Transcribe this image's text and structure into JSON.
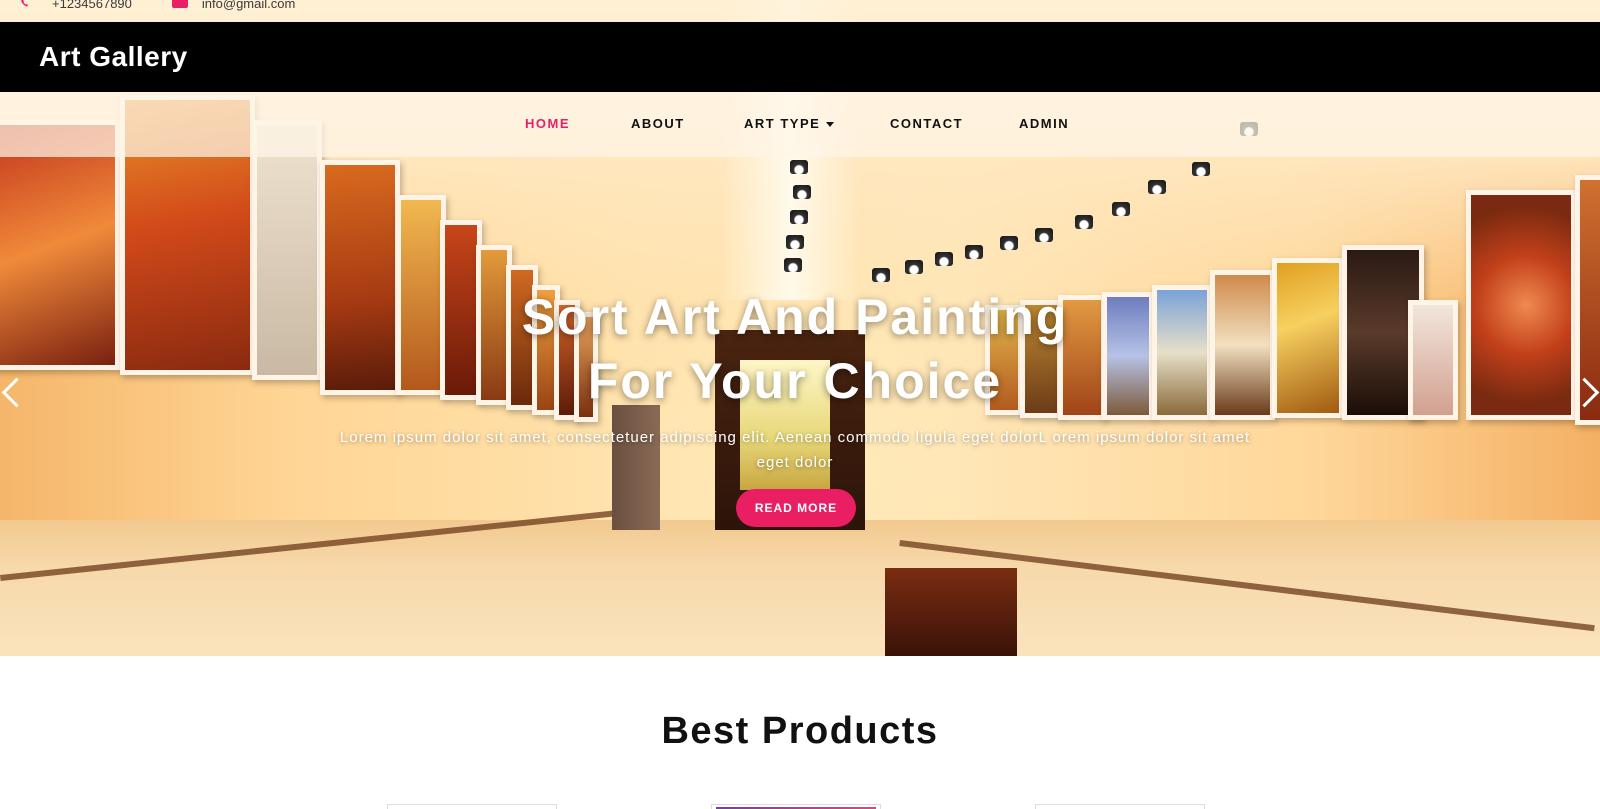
{
  "topbar": {
    "phone": "+1234567890",
    "email": "info@gmail.com"
  },
  "brand": {
    "name": "Art Gallery"
  },
  "nav": {
    "items": [
      {
        "label": "HOME",
        "active": true
      },
      {
        "label": "ABOUT",
        "active": false
      },
      {
        "label": "ART TYPE",
        "active": false,
        "has_dropdown": true
      },
      {
        "label": "CONTACT",
        "active": false
      },
      {
        "label": "ADMIN",
        "active": false
      }
    ]
  },
  "hero": {
    "title_line1": "Sort Art And Painting",
    "title_line2": "For Your Choice",
    "subtitle": "Lorem ipsum dolor sit amet, consectetuer adipiscing elit. Aenean commodo ligula eget dolorL orem ipsum dolor sit amet eget dolor",
    "button_label": "READ MORE"
  },
  "products": {
    "section_title": "Best Products"
  },
  "colors": {
    "accent": "#e91e63",
    "header_bg": "#000000",
    "nav_text": "#111111"
  },
  "icons": {
    "phone": "phone-icon",
    "email": "mail-icon",
    "prev": "chevron-left-icon",
    "next": "chevron-right-icon"
  }
}
